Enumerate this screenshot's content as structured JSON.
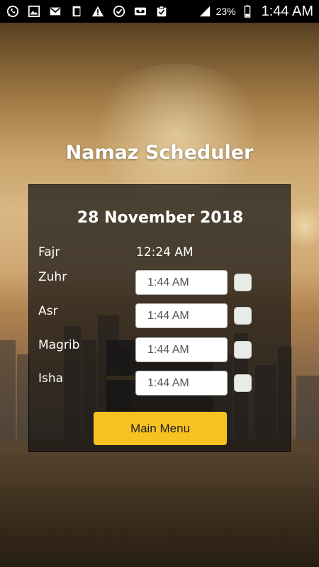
{
  "status_bar": {
    "battery_percent": "23%",
    "time": "1:44 AM",
    "left_icons": [
      "whatsapp-icon",
      "image-icon",
      "gmail-icon",
      "notes-icon",
      "warning-icon",
      "check-circle-icon",
      "voicemail-icon",
      "clipboard-icon"
    ],
    "right_icons": [
      "signal-icon",
      "battery-icon"
    ]
  },
  "app": {
    "title": "Namaz Scheduler",
    "date": "28 November 2018",
    "prayers": [
      {
        "label": "Fajr",
        "time": "12:24 AM"
      },
      {
        "label": "Zuhr",
        "time": "1:44 AM"
      },
      {
        "label": "Asr",
        "time": "1:44 AM"
      },
      {
        "label": "Magrib",
        "time": "1:44 AM"
      },
      {
        "label": "Isha",
        "time": "1:44 AM"
      }
    ],
    "main_menu_label": "Main Menu"
  },
  "colors": {
    "accent_button": "#f7c221",
    "panel_bg": "rgba(20,20,20,0.72)",
    "status_bar": "#000000"
  }
}
